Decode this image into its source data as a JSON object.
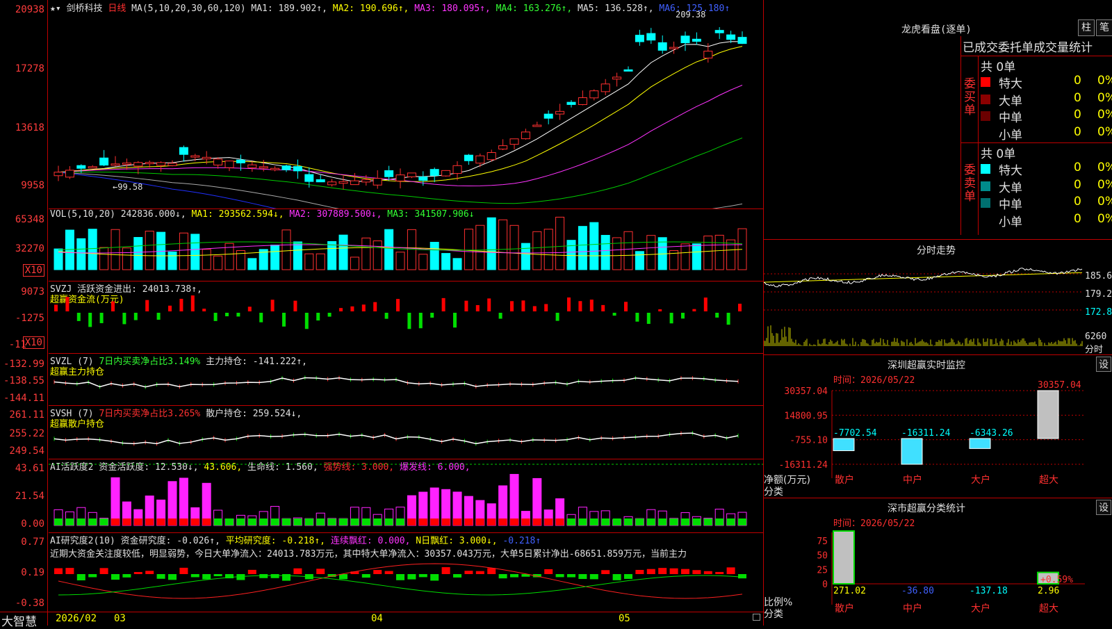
{
  "app": {
    "brand": "大智慧"
  },
  "main_chart": {
    "header_star": "★",
    "header_menu": "▾",
    "stock_name": "剑桥科技",
    "period": "日线",
    "ma_params": "MA(5,10,20,30,60,120)",
    "ma1": "MA1: 189.902↑,",
    "ma2": "MA2: 190.696↑,",
    "ma3": "MA3: 180.095↑,",
    "ma4": "MA4: 163.276↑,",
    "ma5": "MA5: 136.528↑,",
    "ma6": "MA6: 125.180↑",
    "y_ticks": [
      "20938",
      "17278",
      "13618",
      "9958"
    ],
    "high_label": "209.38",
    "low_label": "←99.58"
  },
  "vol": {
    "title": "VOL(5,10,20)",
    "value": "242836.000↓,",
    "ma1": "MA1: 293562.594↓,",
    "ma2": "MA2: 307889.500↓,",
    "ma3": "MA3: 341507.906↓",
    "y_ticks": [
      "65348",
      "32270"
    ],
    "unit": "X10"
  },
  "svzj": {
    "title": "SVZJ",
    "label": "活跃资金进出: 24013.738↑,",
    "subtitle": "超赢资金流(万元)",
    "y_ticks": [
      "9073",
      "-1275",
      "-11"
    ],
    "unit": "X10"
  },
  "svzl": {
    "title": "SVZL  (7)",
    "ratio": "7日内买卖净占比3.149%",
    "holding": "主力持仓: -141.222↑,",
    "subtitle": "超赢主力持仓",
    "y_ticks": [
      "-132.99",
      "-138.55",
      "-144.11"
    ]
  },
  "svsh": {
    "title": "SVSH  (7)",
    "ratio": "7日内买卖净占比3.265%",
    "holding": "散户持仓: 259.524↓,",
    "subtitle": "超赢散户持仓",
    "y_ticks": [
      "261.11",
      "255.22",
      "249.54"
    ]
  },
  "ai_active": {
    "title": "AI活跃度2",
    "activity": "资金活跃度: 12.530↓,",
    "v2": "43.606,",
    "life": "生命线: 1.560,",
    "strong": "强势线: 3.000,",
    "burst": "爆发线: 6.000,",
    "y_ticks": [
      "43.61",
      "21.54",
      "0.00"
    ]
  },
  "ai_research": {
    "title": "AI研究度2(10)",
    "research": "资金研究度: -0.026↑,",
    "avg": "平均研究度: -0.218↑,",
    "red": "连续飘红: 0.000,",
    "nred": "N日飘红: 3.000↓,",
    "last": "-0.218↑",
    "comment": "近期大资金关注度较低，明显弱势，今日大单净流入：24013.783万元，其中特大单净流入：30357.043万元，大单5日累计净出-68651.859万元，当前主力",
    "y_ticks": [
      "0.77",
      "0.19",
      "-0.38"
    ]
  },
  "x_axis": {
    "labels": [
      "2026/02",
      "03",
      "04",
      "05"
    ]
  },
  "dragon_tiger": {
    "title": "龙虎看盘(逐单)",
    "btn_bar": "柱",
    "btn_pen": "笔",
    "tabs": [
      "已成交委托单成交量统计"
    ],
    "buy_side": "委买单",
    "sell_side": "委卖单",
    "buy_total": "共 0单",
    "sell_total": "共 0单",
    "buy_rows": [
      {
        "label": "特大",
        "count": "0",
        "pct": "0%",
        "color": "#ff0000"
      },
      {
        "label": "大单",
        "count": "0",
        "pct": "0%",
        "color": "#8b0000"
      },
      {
        "label": "中单",
        "count": "0",
        "pct": "0%",
        "color": "#6b0000"
      },
      {
        "label": "小单",
        "count": "0",
        "pct": "0%",
        "color": "#000000"
      }
    ],
    "sell_rows": [
      {
        "label": "特大",
        "count": "0",
        "pct": "0%",
        "color": "#00ffff"
      },
      {
        "label": "大单",
        "count": "0",
        "pct": "0%",
        "color": "#008b8b"
      },
      {
        "label": "中单",
        "count": "0",
        "pct": "0%",
        "color": "#007070"
      },
      {
        "label": "小单",
        "count": "0",
        "pct": "0%",
        "color": "#000000"
      }
    ]
  },
  "intraday": {
    "title": "分时走势",
    "prices": [
      "185.6",
      "179.2",
      "172.8"
    ],
    "volume": "6260",
    "unit": "分时"
  },
  "sz_monitor": {
    "title": "深圳超赢实时监控",
    "btn": "设",
    "time": "时间：2026/05/22",
    "y_ticks": [
      "30357.04",
      "14800.95",
      "-755.10",
      "-16311.24"
    ],
    "ylabel": "净额(万元)",
    "xlabel": "分类",
    "categories": [
      "散户",
      "中户",
      "大户",
      "超大"
    ],
    "values_label": [
      "-7702.54",
      "-16311.24",
      "-6343.26",
      "30357.04"
    ]
  },
  "sz_stats": {
    "title": "深市超赢分类统计",
    "btn": "设",
    "time": "时间：2026/05/22",
    "y_ticks": [
      "75",
      "50",
      "25",
      "0"
    ],
    "ylabel": "比例%",
    "xlabel": "分类",
    "categories": [
      "散户",
      "中户",
      "大户",
      "超大"
    ],
    "values_label": [
      "271.02",
      "-36.80",
      "-137.18",
      "2.96"
    ],
    "extra": "+0.59%"
  },
  "chart_data": [
    {
      "type": "monitor-bar",
      "categories": [
        "散户",
        "中户",
        "大户",
        "超大"
      ],
      "values": [
        -7702.54,
        -16311.24,
        -6343.26,
        30357.04
      ],
      "ylim": [
        -16311.24,
        30357.04
      ]
    },
    {
      "type": "bar",
      "categories": [
        "散户",
        "中户",
        "大户",
        "超大"
      ],
      "values": [
        271.02,
        -36.8,
        -137.18,
        2.96
      ],
      "ylim": [
        0,
        75
      ]
    }
  ],
  "colors": {
    "up": "#ff3030",
    "down": "#00ffff",
    "ma1": "#ffffff",
    "ma2": "#ffff00",
    "ma3": "#ff33ff",
    "ma4": "#00cc00",
    "ma5": "#aaaaaa",
    "ma6": "#2030ff",
    "grid": "#c00000"
  }
}
